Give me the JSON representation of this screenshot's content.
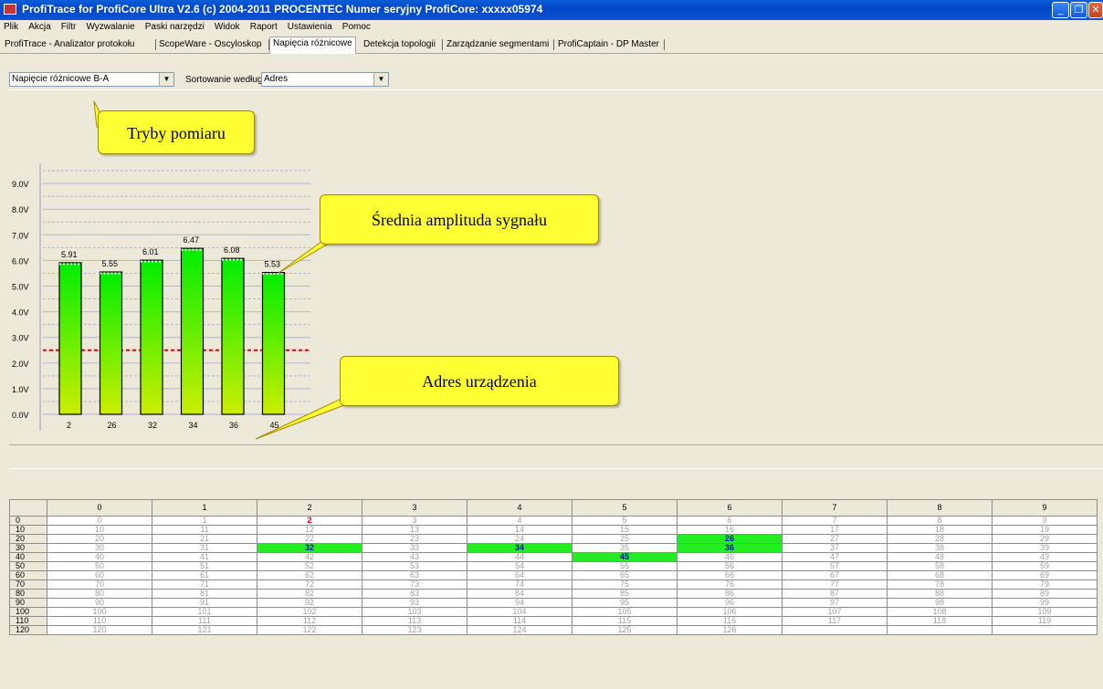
{
  "window": {
    "title": "ProfiTrace for ProfiCore Ultra V2.6 (c) 2004-2011 PROCENTEC  Numer seryjny ProfiCore: xxxxx05974"
  },
  "menu": [
    "Plik",
    "Akcja",
    "Filtr",
    "Wyzwalanie",
    "Paski narzędzi",
    "Widok",
    "Raport",
    "Ustawienia",
    "Pomoc"
  ],
  "tabs": [
    {
      "label": "ProfiTrace - Analizator protokołu",
      "active": false
    },
    {
      "label": "ScopeWare - Oscyloskop",
      "active": false
    },
    {
      "label": "Napięcia różnicowe",
      "active": true
    },
    {
      "label": "Detekcja topologii",
      "active": false
    },
    {
      "label": "Zarządzanie segmentami",
      "active": false
    },
    {
      "label": "ProfiCaptain - DP Master",
      "active": false
    }
  ],
  "controls": {
    "mode_value": "Napięcie różnicowe B-A",
    "sort_label": "Sortowanie według:",
    "sort_value": "Adres"
  },
  "callouts": {
    "modes": "Tryby pomiaru",
    "amplitude": "Średnia amplituda sygnału",
    "address": "Adres urządzenia"
  },
  "chart_data": {
    "type": "bar",
    "categories": [
      "2",
      "26",
      "32",
      "34",
      "36",
      "45"
    ],
    "values": [
      5.91,
      5.55,
      6.01,
      6.47,
      6.08,
      5.53
    ],
    "data_labels": [
      "5.91",
      "5.55",
      "6.01",
      "6.47",
      "6.08",
      "5.53"
    ],
    "y_ticks": [
      "0.0V",
      "1.0V",
      "2.0V",
      "3.0V",
      "4.0V",
      "5.0V",
      "6.0V",
      "7.0V",
      "8.0V",
      "9.0V"
    ],
    "ylim": [
      0,
      10
    ],
    "threshold": 2.5,
    "grid": true,
    "colors": {
      "bar_top": "#00ee00",
      "bar_bottom": "#ccee00",
      "threshold": "#ee0000"
    }
  },
  "grid": {
    "col_headers": [
      "0",
      "1",
      "2",
      "3",
      "4",
      "5",
      "6",
      "7",
      "8",
      "9"
    ],
    "row_headers": [
      "0",
      "10",
      "20",
      "30",
      "40",
      "50",
      "60",
      "70",
      "80",
      "90",
      "100",
      "110",
      "120"
    ],
    "cells": [
      [
        "0",
        "1",
        "2",
        "3",
        "4",
        "5",
        "6",
        "7",
        "8",
        "9"
      ],
      [
        "10",
        "11",
        "12",
        "13",
        "14",
        "15",
        "16",
        "17",
        "18",
        "19"
      ],
      [
        "20",
        "21",
        "22",
        "23",
        "24",
        "25",
        "26",
        "27",
        "28",
        "29"
      ],
      [
        "30",
        "31",
        "32",
        "33",
        "34",
        "35",
        "36",
        "37",
        "38",
        "39"
      ],
      [
        "40",
        "41",
        "42",
        "43",
        "44",
        "45",
        "46",
        "47",
        "48",
        "49"
      ],
      [
        "50",
        "51",
        "52",
        "53",
        "54",
        "55",
        "56",
        "57",
        "58",
        "59"
      ],
      [
        "60",
        "61",
        "62",
        "63",
        "64",
        "65",
        "66",
        "67",
        "68",
        "69"
      ],
      [
        "70",
        "71",
        "72",
        "73",
        "74",
        "75",
        "76",
        "77",
        "78",
        "79"
      ],
      [
        "80",
        "81",
        "82",
        "83",
        "84",
        "85",
        "86",
        "87",
        "88",
        "89"
      ],
      [
        "90",
        "91",
        "92",
        "93",
        "94",
        "95",
        "96",
        "97",
        "98",
        "99"
      ],
      [
        "100",
        "101",
        "102",
        "103",
        "104",
        "105",
        "106",
        "107",
        "108",
        "109"
      ],
      [
        "110",
        "111",
        "112",
        "113",
        "114",
        "115",
        "116",
        "117",
        "118",
        "119"
      ],
      [
        "120",
        "121",
        "122",
        "123",
        "124",
        "125",
        "126",
        "",
        "",
        ""
      ]
    ],
    "active_addresses": [
      "26",
      "32",
      "34",
      "36",
      "45"
    ],
    "red_addresses": [
      "2"
    ],
    "selected_address": "46"
  }
}
